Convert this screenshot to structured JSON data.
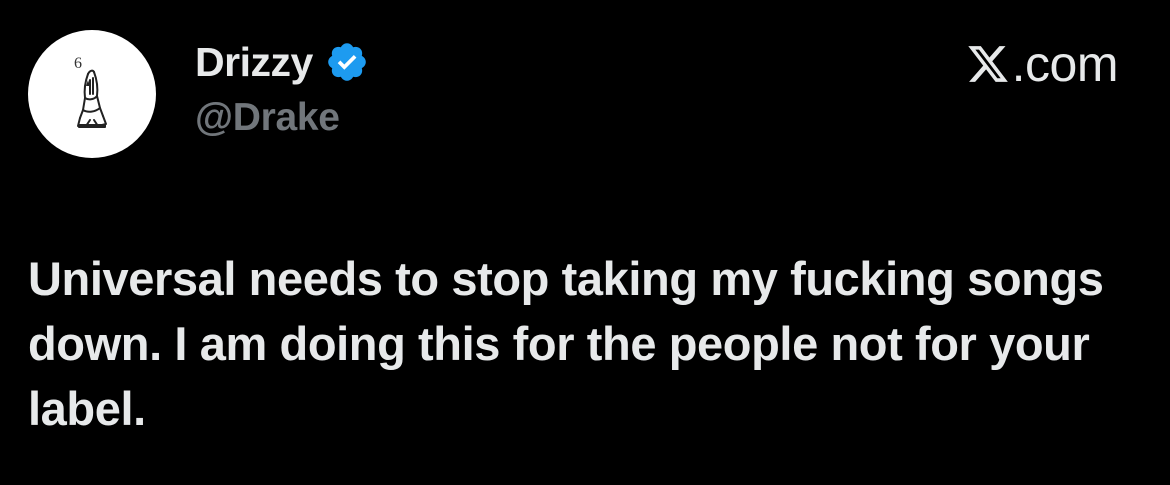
{
  "author": {
    "display_name": "Drizzy",
    "handle": "@Drake",
    "verified": true,
    "avatar_icon": "praying-hands-icon",
    "avatar_text": "6"
  },
  "site": {
    "label": ".com",
    "logo_icon": "x-logo-icon"
  },
  "tweet": {
    "text": "Universal needs to stop taking my fucking songs down. I am doing this for the people not for your label."
  },
  "colors": {
    "background": "#000000",
    "text_primary": "#e7e9ea",
    "text_secondary": "#71767b",
    "verified_blue": "#1d9bf0"
  }
}
